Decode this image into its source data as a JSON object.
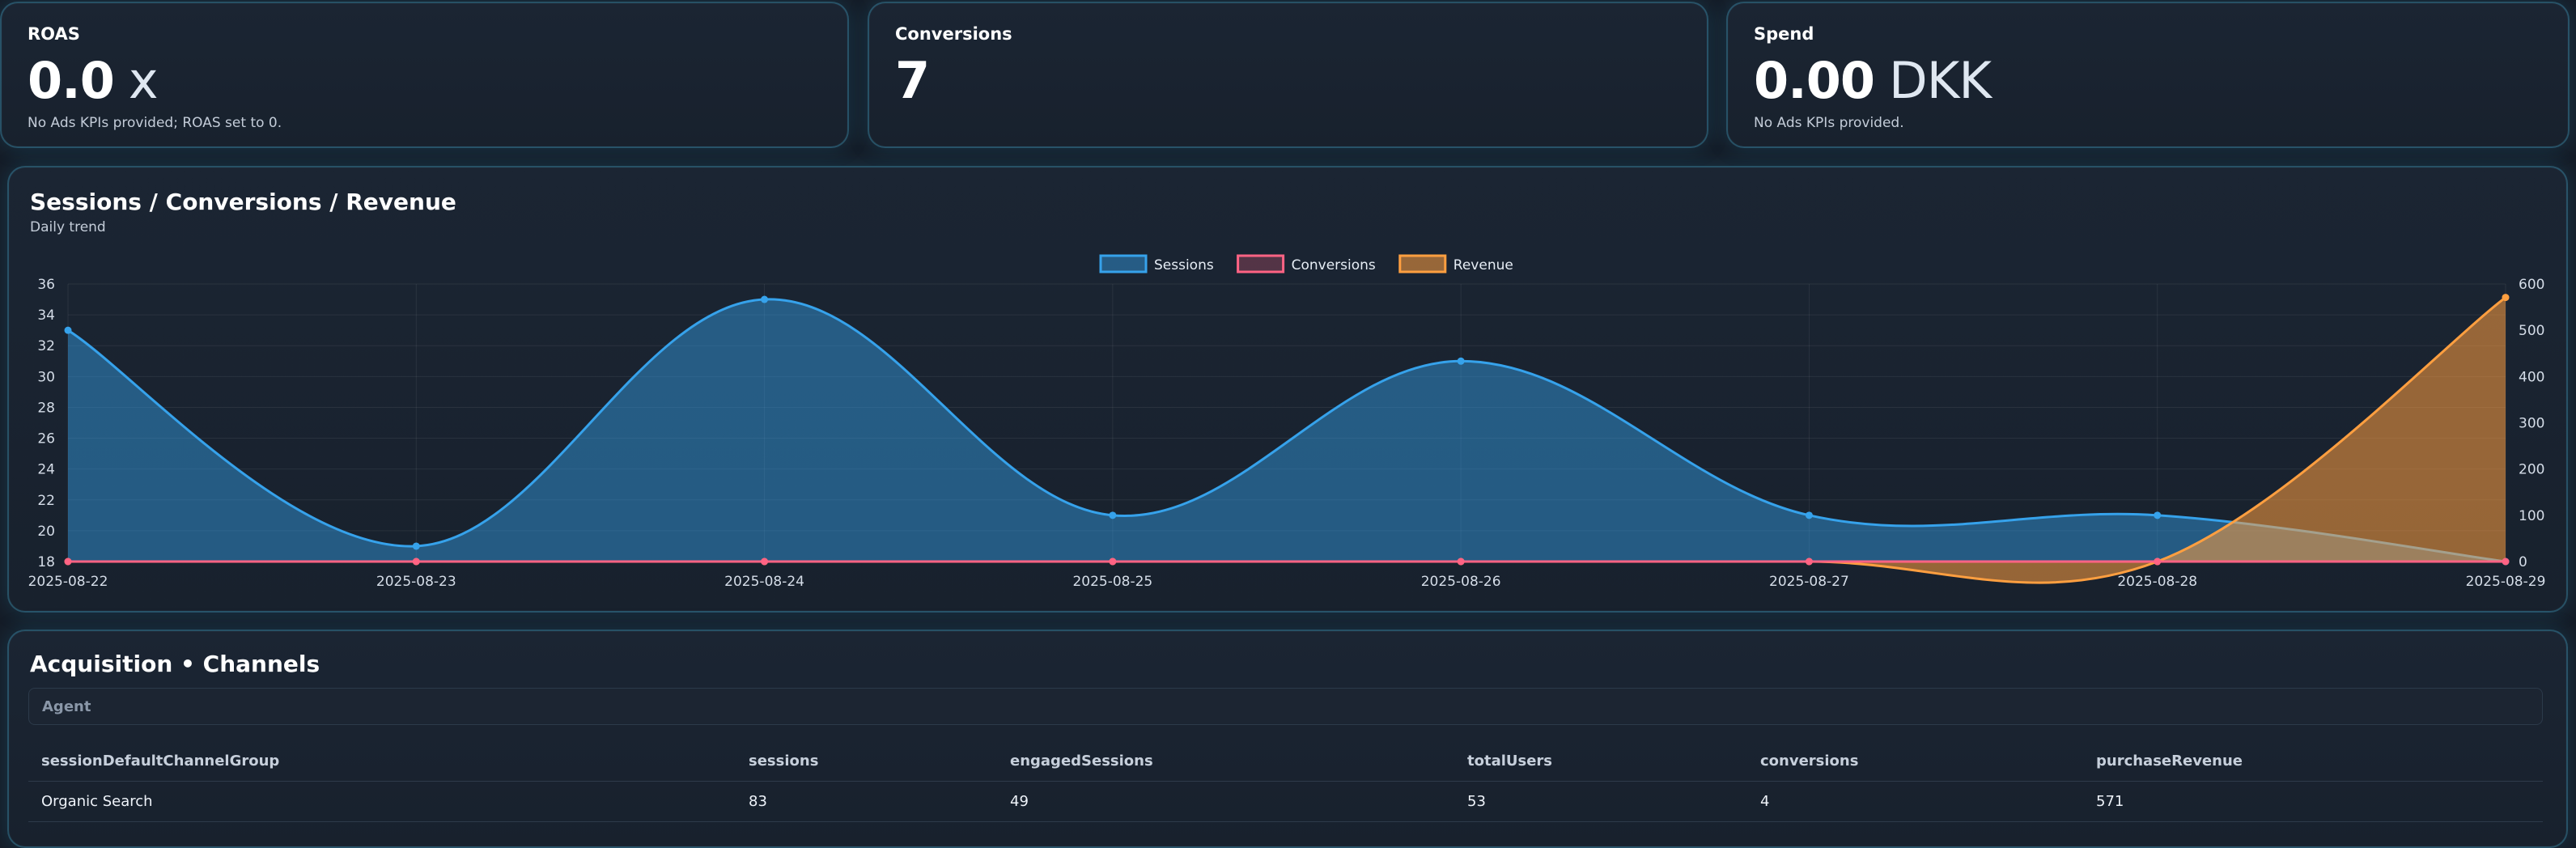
{
  "kpis": [
    {
      "label": "ROAS",
      "value": "0.0",
      "unit": "x",
      "note": "No Ads KPIs provided; ROAS set to 0."
    },
    {
      "label": "Conversions",
      "value": "7",
      "unit": "",
      "note": ""
    },
    {
      "label": "Spend",
      "value": "0.00",
      "unit": "DKK",
      "note": "No Ads KPIs provided."
    }
  ],
  "trend": {
    "title": "Sessions / Conversions / Revenue",
    "subtitle": "Daily trend"
  },
  "chart_data": {
    "type": "line",
    "x": [
      "2025-08-22",
      "2025-08-23",
      "2025-08-24",
      "2025-08-25",
      "2025-08-26",
      "2025-08-27",
      "2025-08-28",
      "2025-08-29"
    ],
    "series": [
      {
        "name": "Sessions",
        "axis": "left",
        "values": [
          33,
          19,
          35,
          21,
          31,
          21,
          21,
          18
        ],
        "color": "#36a2eb"
      },
      {
        "name": "Conversions",
        "axis": "left",
        "values": [
          0,
          0,
          0,
          0,
          0,
          0,
          0,
          7
        ],
        "color": "#ff6384"
      },
      {
        "name": "Revenue",
        "axis": "right",
        "values": [
          0,
          0,
          0,
          0,
          0,
          0,
          0,
          571
        ],
        "color": "#ff9f40"
      }
    ],
    "y_left": {
      "ticks": [
        "36",
        "34",
        "32",
        "30",
        "28",
        "26",
        "24",
        "22",
        "20",
        "18"
      ],
      "min": 18,
      "max": 36
    },
    "y_right": {
      "ticks": [
        "600",
        "500",
        "400",
        "300",
        "200",
        "100",
        "0"
      ],
      "min": 0,
      "max": 600
    },
    "legend": "top-center",
    "grid": true,
    "area_fill": true,
    "smooth": true
  },
  "acquisition": {
    "title": "Acquisition • Channels",
    "agent_label": "Agent",
    "columns": [
      "sessionDefaultChannelGroup",
      "sessions",
      "engagedSessions",
      "totalUsers",
      "conversions",
      "purchaseRevenue"
    ],
    "rows": [
      [
        "Organic Search",
        "83",
        "49",
        "53",
        "4",
        "571"
      ]
    ]
  }
}
